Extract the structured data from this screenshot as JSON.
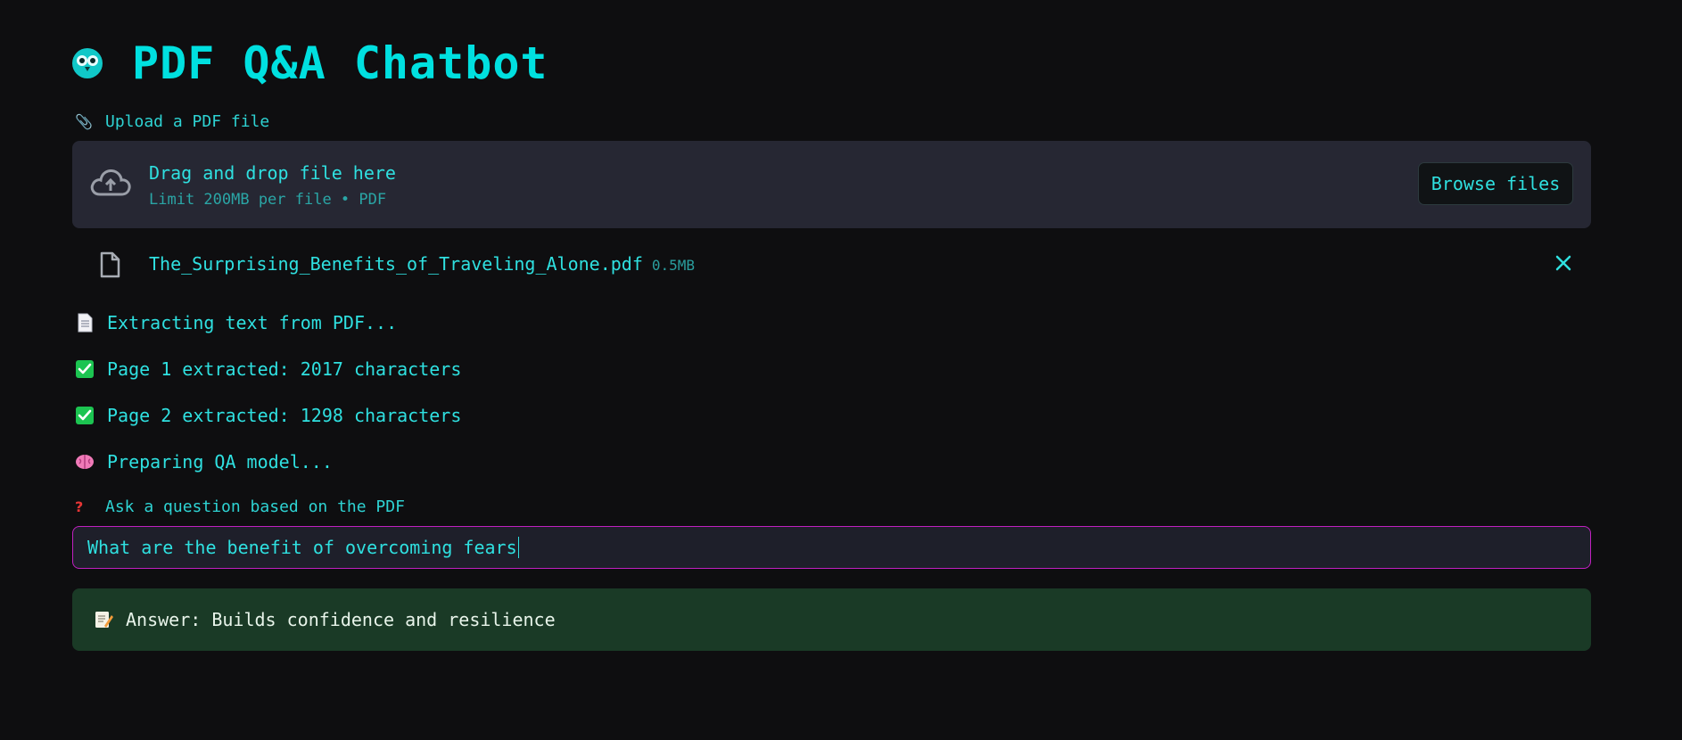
{
  "app": {
    "title": "PDF Q&A Chatbot",
    "title_icon": "owl-emoji-icon"
  },
  "upload": {
    "label": "Upload a PDF file",
    "label_icon": "paperclip-icon",
    "dropzone_title": "Drag and drop file here",
    "dropzone_subtitle": "Limit 200MB per file • PDF",
    "browse_label": "Browse files"
  },
  "file": {
    "name": "The_Surprising_Benefits_of_Traveling_Alone.pdf",
    "size": "0.5MB"
  },
  "status": [
    {
      "icon": "page-icon",
      "text": "Extracting text from PDF..."
    },
    {
      "icon": "check-mark-icon",
      "text": "Page 1 extracted: 2017 characters"
    },
    {
      "icon": "check-mark-icon",
      "text": "Page 2 extracted: 1298 characters"
    },
    {
      "icon": "brain-icon",
      "text": "Preparing QA model..."
    }
  ],
  "question": {
    "label": "Ask a question based on the PDF",
    "label_icon": "question-mark-icon",
    "value": "What are the benefit of overcoming fears"
  },
  "answer": {
    "icon": "memo-icon",
    "text": "Answer: Builds confidence and resilience"
  },
  "colors": {
    "background": "#0e0e10",
    "accent": "#00e0e0",
    "input_border": "#c020c0",
    "answer_bg": "#1a3a26"
  }
}
